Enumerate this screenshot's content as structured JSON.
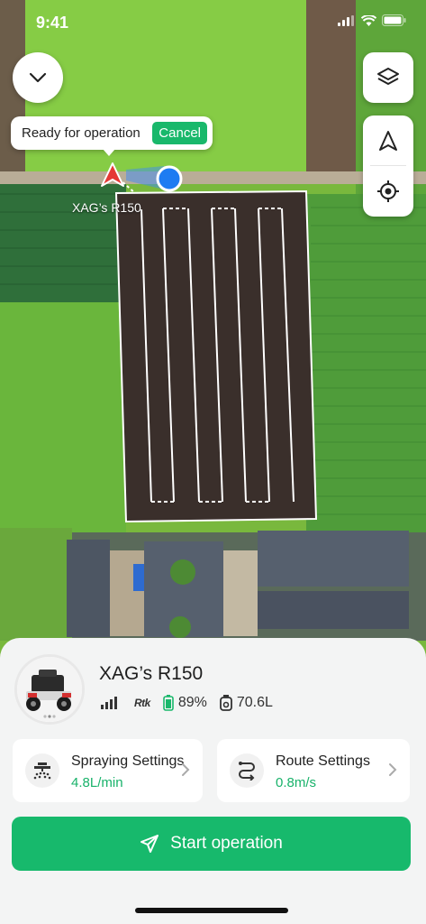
{
  "status_bar": {
    "time": "9:41"
  },
  "map": {
    "operation_status": "Ready for operation",
    "cancel_label": "Cancel",
    "drone_label": "XAG’s R150"
  },
  "device": {
    "name": "XAG’s R150",
    "rtk_label": "Rtk",
    "battery": "89%",
    "tank": "70.6L"
  },
  "cards": {
    "spraying": {
      "title": "Spraying Settings",
      "value": "4.8L/min"
    },
    "route": {
      "title": "Route Settings",
      "value": "0.8m/s"
    }
  },
  "actions": {
    "start_label": "Start operation"
  },
  "icons": [
    "chevron-down-icon",
    "layers-icon",
    "navigation-arrow-icon",
    "locate-icon",
    "signal-icon",
    "rtk-icon",
    "battery-icon",
    "tank-icon",
    "sprayer-icon",
    "route-icon",
    "chevron-right-icon",
    "send-icon"
  ],
  "colors": {
    "accent": "#17b96c",
    "field_boundary": "#ffffff",
    "drone_marker": "#e53935",
    "location_dot": "#1e7cf2"
  }
}
